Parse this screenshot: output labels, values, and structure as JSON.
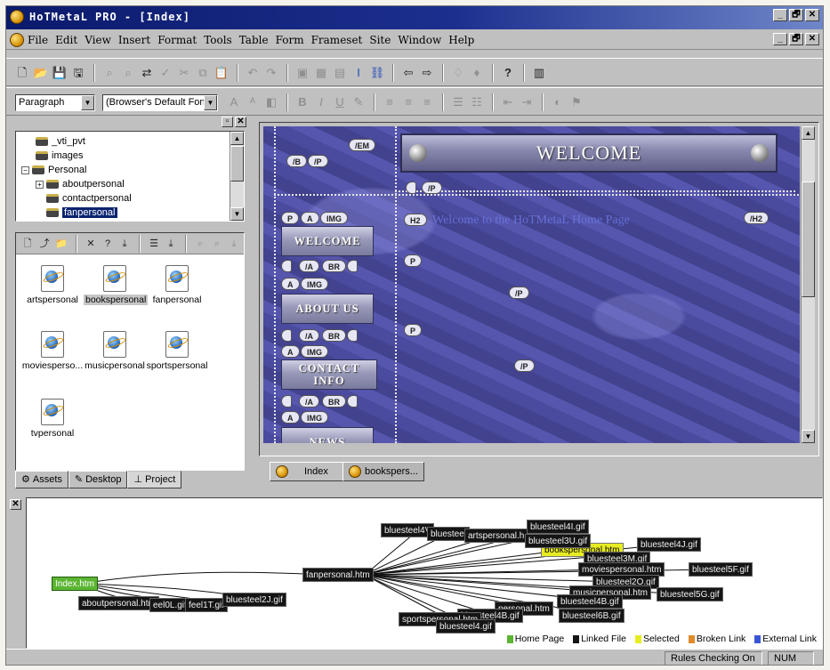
{
  "titlebar": {
    "title": "HoTMetaL PRO - [Index]",
    "window_buttons": [
      "_",
      "🗗",
      "✕"
    ]
  },
  "menubar": {
    "items": [
      "File",
      "Edit",
      "View",
      "Insert",
      "Format",
      "Tools",
      "Table",
      "Form",
      "Frameset",
      "Site",
      "Window",
      "Help"
    ],
    "doc_buttons": [
      "_",
      "🗗",
      "✕"
    ]
  },
  "format_toolbar": {
    "style_select": "Paragraph",
    "font_select": "(Browser's Default Font)"
  },
  "tree": {
    "items": [
      {
        "label": "_vti_pvt",
        "level": 1
      },
      {
        "label": "images",
        "level": 1
      },
      {
        "label": "Personal",
        "level": 0,
        "expander": "−"
      },
      {
        "label": "aboutpersonal",
        "level": 1,
        "expander": "+"
      },
      {
        "label": "contactpersonal",
        "level": 1
      },
      {
        "label": "fanpersonal",
        "level": 1,
        "selected": true
      }
    ]
  },
  "files": [
    {
      "label": "artspersonal"
    },
    {
      "label": "bookspersonal",
      "selected": true
    },
    {
      "label": "fanpersonal"
    },
    {
      "label": "moviesperso..."
    },
    {
      "label": "musicpersonal"
    },
    {
      "label": "sportspersonal"
    },
    {
      "label": "tvpersonal"
    }
  ],
  "left_tabs": [
    {
      "label": "Assets",
      "icon": "assets-icon"
    },
    {
      "label": "Desktop",
      "icon": "desktop-icon"
    },
    {
      "label": "Project",
      "icon": "project-icon",
      "active": true
    }
  ],
  "editor": {
    "banner": "WELCOME",
    "welcome_text": "Welcome to the HoTMetaL Home Page",
    "nav_buttons": [
      "WELCOME",
      "ABOUT US",
      "CONTACT INFO",
      "NEWS"
    ],
    "tags": {
      "em_close": "/EM",
      "b": "/B",
      "p_close": "/P",
      "p": "P",
      "a": "A",
      "img": "IMG",
      "a_close": "/A",
      "br": "BR",
      "h2": "H2",
      "h2_close": "/H2"
    }
  },
  "doc_tabs": [
    {
      "label": "Index",
      "active": true
    },
    {
      "label": "bookspers..."
    }
  ],
  "sitemap": {
    "home": "Index.htm",
    "hub": "fanpersonal.htm",
    "selected": "bookspersonal.htm",
    "left_nodes": [
      "aboutpersonal.htm",
      "eel0L.gif",
      "feel1T.gif",
      "bluesteel2J.gif"
    ],
    "right_nodes": [
      "bluesteel4V",
      "bluesteel",
      "artspersonal.h",
      "bluesteel3U.gif",
      "bluesteel4I.gif",
      "bluesteel4J.gif",
      "bluesteel3M.gif",
      "moviespersonal.htm",
      "bluesteel5F.gif",
      "bluesteel2O.gif",
      "bluesteel5G.gif",
      "musicpersonal.htm",
      "bluesteel4B.gif",
      "bluesteel6B.gif",
      "personal.htm",
      "bluesteel4B.gif",
      "sportspersonal.htm",
      "bluesteel4.gif"
    ],
    "legend": [
      {
        "label": "Home Page",
        "color": "#5bb532"
      },
      {
        "label": "Linked File",
        "color": "#151515"
      },
      {
        "label": "Selected",
        "color": "#e7ec22"
      },
      {
        "label": "Broken Link",
        "color": "#e08a2a"
      },
      {
        "label": "External Link",
        "color": "#3a56d6"
      }
    ]
  },
  "status": {
    "rules": "Rules Checking On",
    "num": "NUM"
  }
}
